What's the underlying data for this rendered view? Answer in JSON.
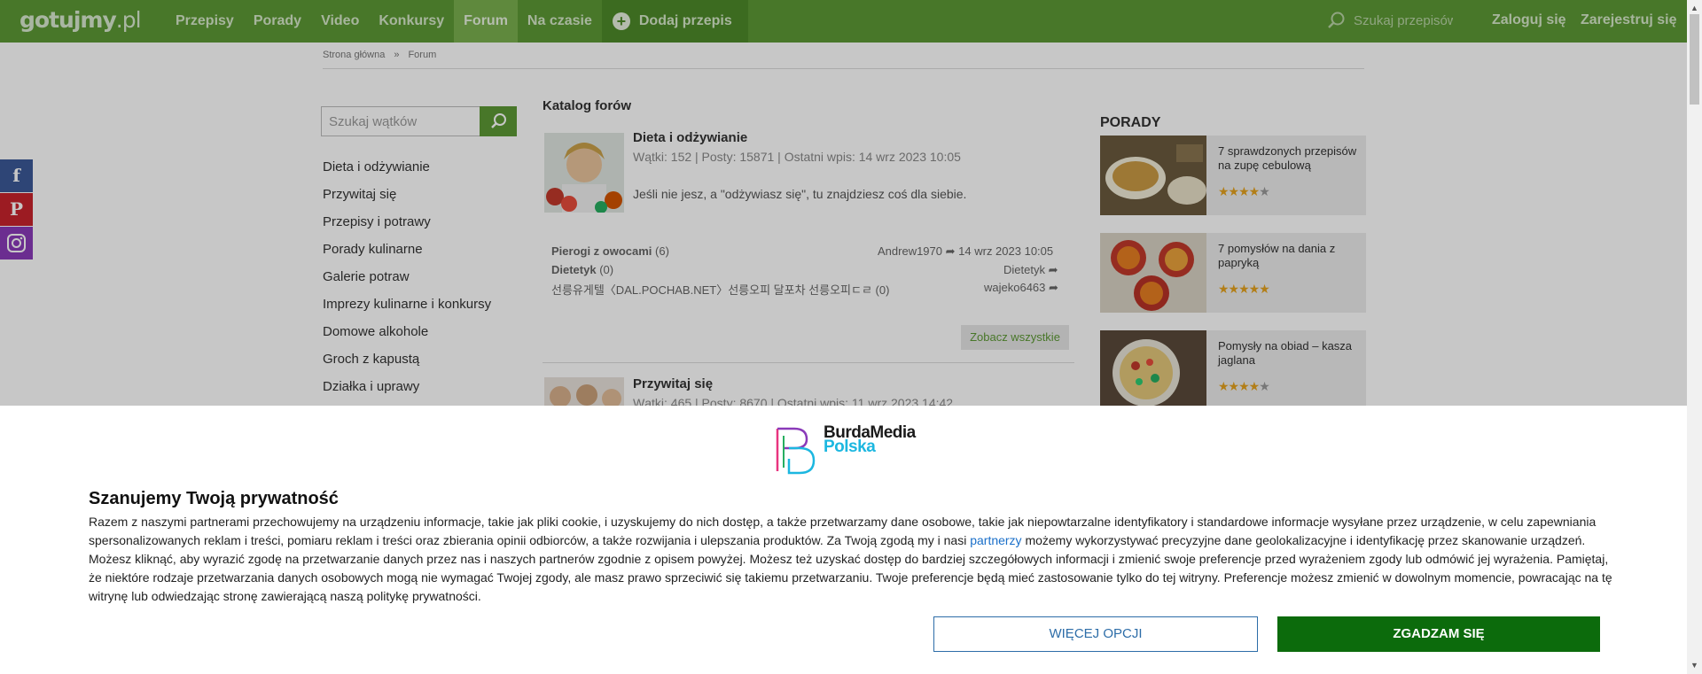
{
  "header": {
    "logo_main": "gotujmy",
    "logo_suffix": ".pl",
    "nav": [
      "Przepisy",
      "Porady",
      "Video",
      "Konkursy",
      "Forum",
      "Na czasie"
    ],
    "add_recipe": "Dodaj przepis",
    "search_placeholder": "Szukaj przepisów",
    "login": "Zaloguj się",
    "register": "Zarejestruj się"
  },
  "breadcrumb": {
    "home": "Strona główna",
    "sep": "»",
    "current": "Forum"
  },
  "sidebar": {
    "search_placeholder": "Szukaj wątków",
    "categories": [
      "Dieta i odżywianie",
      "Przywitaj się",
      "Przepisy i potrawy",
      "Porady kulinarne",
      "Galerie potraw",
      "Imprezy kulinarne i konkursy",
      "Domowe alkohole",
      "Groch z kapustą",
      "Działka i uprawy"
    ]
  },
  "catalog": {
    "title": "Katalog forów",
    "forums": [
      {
        "name": "Dieta i odżywianie",
        "stats": "Wątki: 152  |  Posty: 15871  |  Ostatni wpis: 14 wrz 2023 10:05",
        "desc": "Jeśli nie jesz, a \"odżywiasz się\", tu znajdziesz coś dla siebie."
      },
      {
        "name": "Przywitaj się",
        "stats": "Wątki: 465  |  Posty: 8670  |  Ostatni wpis: 11 wrz 2023 14:42"
      }
    ],
    "threads": [
      {
        "title": "Pierogi z owocami",
        "count": "(6)",
        "author": "Andrew1970",
        "date": "14 wrz 2023 10:05"
      },
      {
        "title": "Dietetyk",
        "count": "(0)",
        "author": "Dietetyk",
        "date": ""
      },
      {
        "title": "선릉유게텔〈DAL.POCHAB.NET〉선릉오피 달포차 선릉오피ㄷㄹ",
        "count": "(0)",
        "author": "wajeko6463",
        "date": ""
      }
    ],
    "see_all": "Zobacz wszystkie"
  },
  "porady": {
    "title": "PORADY",
    "items": [
      {
        "text": "7 sprawdzonych przepisów na zupę cebulową",
        "rating": 4
      },
      {
        "text": "7 pomysłów na dania z papryką",
        "rating": 5
      },
      {
        "text": "Pomysły na obiad – kasza jaglana",
        "rating": 4
      }
    ]
  },
  "consent": {
    "brand_line1": "BurdaMedia",
    "brand_line2": "Polska",
    "title": "Szanujemy Twoją prywatność",
    "text_before_link": "Razem z naszymi partnerami przechowujemy na urządzeniu informacje, takie jak pliki cookie, i uzyskujemy do nich dostęp, a także przetwarzamy dane osobowe, takie jak niepowtarzalne identyfikatory i standardowe informacje wysyłane przez urządzenie, w celu zapewniania spersonalizowanych reklam i treści, pomiaru reklam i treści oraz zbierania opinii odbiorców, a także rozwijania i ulepszania produktów. Za Twoją zgodą my i nasi ",
    "link": "partnerzy",
    "text_after_link": " możemy wykorzystywać precyzyjne dane geolokalizacyjne i identyfikację przez skanowanie urządzeń. Możesz kliknąć, aby wyrazić zgodę na przetwarzanie danych przez nas i naszych partnerów zgodnie z opisem powyżej. Możesz też uzyskać dostęp do bardziej szczegółowych informacji i zmienić swoje preferencje przed wyrażeniem zgody lub odmówić jej wyrażenia. Pamiętaj, że niektóre rodzaje przetwarzania danych osobowych mogą nie wymagać Twojej zgody, ale masz prawo sprzeciwić się takiemu przetwarzaniu. Twoje preferencje będą mieć zastosowanie tylko do tej witryny. Preferencje możesz zmienić w dowolnym momencie, powracając na tę witrynę lub odwiedzając stronę zawierającą naszą politykę prywatności.",
    "more_options": "WIĘCEJ OPCJI",
    "agree": "ZGADZAM SIĘ"
  },
  "colors": {
    "brand_green": "#5d9935",
    "agree_button": "#0c6b0c",
    "link_blue": "#1a6fc9",
    "facebook": "#3b5998",
    "pinterest": "#c8232c",
    "instagram": "#8a3ab9"
  }
}
